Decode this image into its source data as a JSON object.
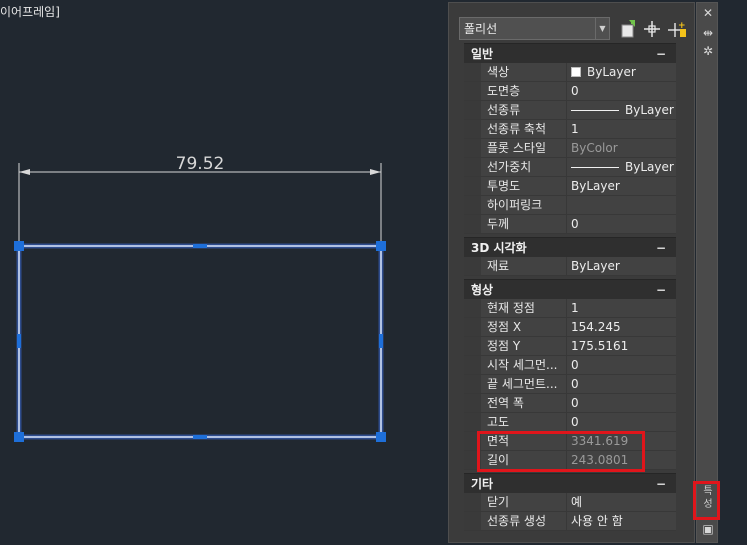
{
  "viewport": {
    "label": "이어프레임]"
  },
  "drawing": {
    "dimension_text": "79.52",
    "line_color": "#9fc0ff",
    "grip_color": "#1e6fd9"
  },
  "palette": {
    "selector_value": "폴리선",
    "toolbar_icons": [
      "quick-select-icon",
      "select-objects-icon",
      "toggle-pickadd-icon"
    ],
    "strip_icons": [
      "close-icon",
      "auto-hide-icon",
      "settings-icon"
    ],
    "strip_tab_label": "특성",
    "sections": [
      {
        "title": "일반",
        "collapse": "−",
        "rows": [
          {
            "name": "색상",
            "value": "ByLayer",
            "swatch": true
          },
          {
            "name": "도면층",
            "value": "0"
          },
          {
            "name": "선종류",
            "value": "ByLayer",
            "linetype": true
          },
          {
            "name": "선종류 축척",
            "value": "1"
          },
          {
            "name": "플롯 스타일",
            "value": "ByColor",
            "dim": true
          },
          {
            "name": "선가중치",
            "value": "ByLayer",
            "linetype": true
          },
          {
            "name": "투명도",
            "value": "ByLayer"
          },
          {
            "name": "하이퍼링크",
            "value": ""
          },
          {
            "name": "두께",
            "value": "0"
          }
        ]
      },
      {
        "title": "3D 시각화",
        "collapse": "−",
        "rows": [
          {
            "name": "재료",
            "value": "ByLayer"
          }
        ]
      },
      {
        "title": "형상",
        "collapse": "−",
        "rows": [
          {
            "name": "현재 정점",
            "value": "1"
          },
          {
            "name": "정점 X",
            "value": "154.245"
          },
          {
            "name": "정점 Y",
            "value": "175.5161"
          },
          {
            "name": "시작 세그먼...",
            "value": "0"
          },
          {
            "name": "끝 세그먼트...",
            "value": "0"
          },
          {
            "name": "전역 폭",
            "value": "0"
          },
          {
            "name": "고도",
            "value": "0"
          },
          {
            "name": "면적",
            "value": "3341.619",
            "dim": true
          },
          {
            "name": "길이",
            "value": "243.0801",
            "dim": true
          }
        ]
      },
      {
        "title": "기타",
        "collapse": "−",
        "rows": [
          {
            "name": "닫기",
            "value": "예"
          },
          {
            "name": "선종류 생성",
            "value": "사용 안 함"
          }
        ]
      }
    ],
    "highlight_color": "#e0151b"
  }
}
